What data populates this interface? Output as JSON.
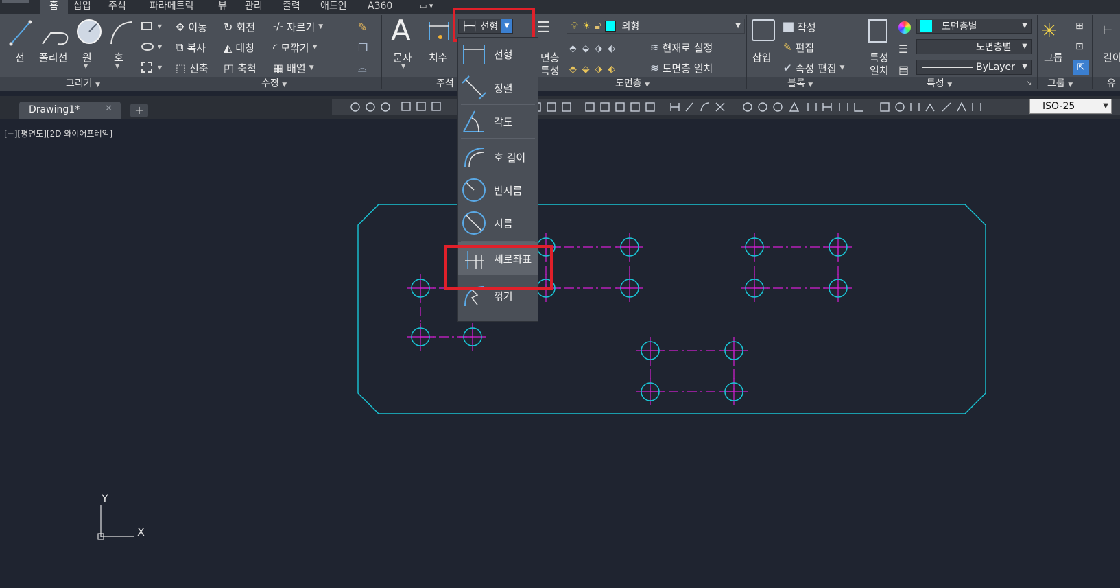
{
  "ribbon_tabs": [
    "홈",
    "삽입",
    "주석",
    "파라메트릭",
    "뷰",
    "관리",
    "출력",
    "애드인",
    "A360"
  ],
  "draw_panel": {
    "title": "그리기",
    "tools": [
      "선",
      "폴리선",
      "원",
      "호"
    ]
  },
  "modify_panel": {
    "title": "수정",
    "row1": [
      "이동",
      "회전",
      "자르기"
    ],
    "row2": [
      "복사",
      "대칭",
      "모깎기"
    ],
    "row3": [
      "신축",
      "축척",
      "배열"
    ]
  },
  "annotation_panel": {
    "title": "주석",
    "text_tool": "문자",
    "dim_tool": "치수"
  },
  "dim_combo": {
    "value": "선형"
  },
  "dim_dropdown": {
    "items": [
      "선형",
      "정렬",
      "각도",
      "호 길이",
      "반지름",
      "지름",
      "세로좌표",
      "꺾기"
    ],
    "selected": "세로좌표"
  },
  "layers_panel": {
    "title": "도면층",
    "layer_props_label": [
      "면층",
      "특성"
    ],
    "current_layer": "외형",
    "set_current": "현재로 설정",
    "match_layer": "도면층 일치"
  },
  "block_panel": {
    "title": "블록",
    "insert": "삽입",
    "create": "작성",
    "edit": "편집",
    "edit_attr": "속성 편집"
  },
  "properties_panel": {
    "title": "특성",
    "match_label": [
      "특성",
      "일치"
    ],
    "color": "도면층별",
    "linetype": "도면층별",
    "lineweight": "ByLayer"
  },
  "group_panel": {
    "title": "그룹",
    "label": "그룹"
  },
  "util_panel": {
    "title": "유",
    "label": "길이"
  },
  "document_tab": {
    "name": "Drawing1*"
  },
  "dim_style": "ISO-25",
  "viewport_label": "[−][평면도][2D 와이어프레임]",
  "ucs": {
    "x": "X",
    "y": "Y"
  },
  "colors": {
    "outline": "#19c5d6",
    "centerline": "#d41fd4",
    "background": "#1f2430",
    "highlight": "#e0202a"
  }
}
